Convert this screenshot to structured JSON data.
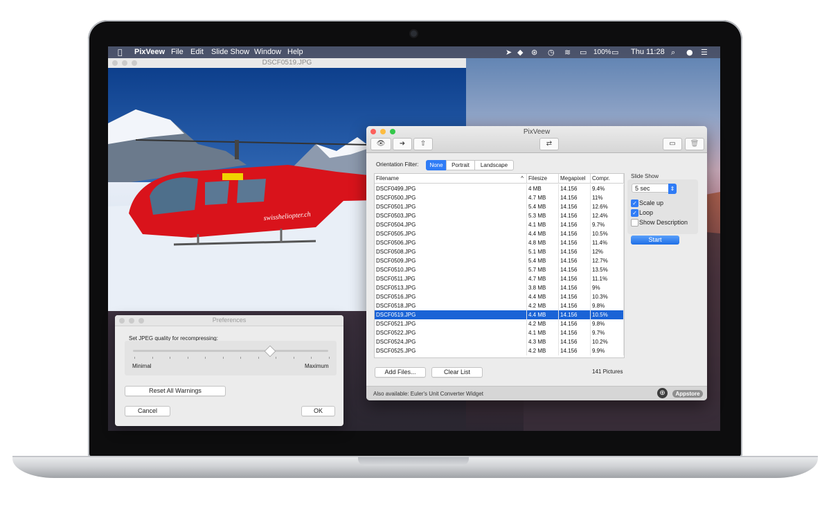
{
  "menubar": {
    "app": "PixVeew",
    "items": [
      "File",
      "Edit",
      "Slide Show",
      "Window",
      "Help"
    ],
    "battery": "100%",
    "clock": "Thu 11:28"
  },
  "image_window": {
    "title": "DSCF0519.JPG",
    "photo_text": "swissheliopter.ch"
  },
  "main_window": {
    "title": "PixVeew",
    "toolbar": {
      "eye": "👁",
      "forward": "➜",
      "share": "⇧",
      "shuffle": "⇄",
      "image": "▭",
      "trash": "🗑"
    },
    "orientation_filter_label": "Orientation Filter:",
    "orientation_options": [
      "None",
      "Portrait",
      "Landscape"
    ],
    "columns": [
      "Filename",
      "Filesize",
      "Megapixel",
      "Compr."
    ],
    "sort_arrow": "^",
    "rows": [
      [
        "DSCF0499.JPG",
        "4 MB",
        "14.156",
        "9.4%"
      ],
      [
        "DSCF0500.JPG",
        "4.7 MB",
        "14.156",
        "11%"
      ],
      [
        "DSCF0501.JPG",
        "5.4 MB",
        "14.156",
        "12.6%"
      ],
      [
        "DSCF0503.JPG",
        "5.3 MB",
        "14.156",
        "12.4%"
      ],
      [
        "DSCF0504.JPG",
        "4.1 MB",
        "14.156",
        "9.7%"
      ],
      [
        "DSCF0505.JPG",
        "4.4 MB",
        "14.156",
        "10.5%"
      ],
      [
        "DSCF0506.JPG",
        "4.8 MB",
        "14.156",
        "11.4%"
      ],
      [
        "DSCF0508.JPG",
        "5.1 MB",
        "14.156",
        "12%"
      ],
      [
        "DSCF0509.JPG",
        "5.4 MB",
        "14.156",
        "12.7%"
      ],
      [
        "DSCF0510.JPG",
        "5.7 MB",
        "14.156",
        "13.5%"
      ],
      [
        "DSCF0511.JPG",
        "4.7 MB",
        "14.156",
        "11.1%"
      ],
      [
        "DSCF0513.JPG",
        "3.8 MB",
        "14.156",
        "9%"
      ],
      [
        "DSCF0516.JPG",
        "4.4 MB",
        "14.156",
        "10.3%"
      ],
      [
        "DSCF0518.JPG",
        "4.2 MB",
        "14.156",
        "9.8%"
      ],
      [
        "DSCF0519.JPG",
        "4.4 MB",
        "14.156",
        "10.5%"
      ],
      [
        "DSCF0521.JPG",
        "4.2 MB",
        "14.156",
        "9.8%"
      ],
      [
        "DSCF0522.JPG",
        "4.1 MB",
        "14.156",
        "9.7%"
      ],
      [
        "DSCF0524.JPG",
        "4.3 MB",
        "14.156",
        "10.2%"
      ],
      [
        "DSCF0525.JPG",
        "4.2 MB",
        "14.156",
        "9.9%"
      ]
    ],
    "selected_row": 14,
    "add_files_label": "Add Files...",
    "clear_list_label": "Clear List",
    "count": "141 Pictures",
    "slideshow": {
      "label": "Slide Show",
      "interval": "5 sec",
      "scale_up_label": "Scale up",
      "scale_up": true,
      "loop_label": "Loop",
      "loop": true,
      "show_description_label": "Show Description",
      "show_description": false,
      "start_label": "Start"
    },
    "footer_text": "Also available: Euler's Unit Converter Widget",
    "appstore_label": "Appstore"
  },
  "preferences": {
    "title": "Preferences",
    "jpeg_label": "Set JPEG quality for recompressing:",
    "min_label": "Minimal",
    "max_label": "Maximum",
    "quality_fraction": 0.7,
    "reset_label": "Reset All Warnings",
    "cancel_label": "Cancel",
    "ok_label": "OK"
  }
}
